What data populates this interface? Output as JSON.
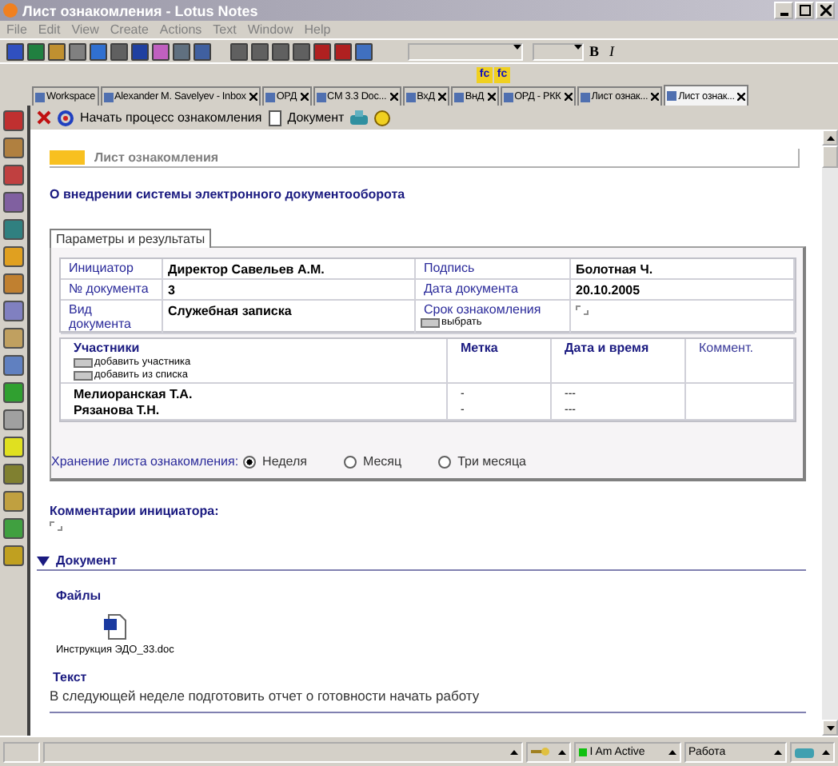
{
  "window": {
    "title": "Лист ознакомления - Lotus Notes"
  },
  "menu": [
    "File",
    "Edit",
    "View",
    "Create",
    "Actions",
    "Text",
    "Window",
    "Help"
  ],
  "format_buttons": [
    "B",
    "I"
  ],
  "formula_buttons": [
    "fc",
    "fc"
  ],
  "tabs": [
    {
      "label": "Workspace",
      "selected": false,
      "closable": false
    },
    {
      "label": "Alexander M. Savelyev - Inbox",
      "selected": false,
      "closable": true
    },
    {
      "label": "ОРД",
      "selected": false,
      "closable": true
    },
    {
      "label": "CM 3.3 Doc...",
      "selected": false,
      "closable": true
    },
    {
      "label": "ВхД",
      "selected": false,
      "closable": true
    },
    {
      "label": "ВнД",
      "selected": false,
      "closable": true
    },
    {
      "label": "ОРД - РКК",
      "selected": false,
      "closable": true
    },
    {
      "label": "Лист ознак...",
      "selected": false,
      "closable": true
    },
    {
      "label": "Лист ознак...",
      "selected": true,
      "closable": true
    }
  ],
  "action_bar": [
    "Начать процесс ознакомления",
    "Документ"
  ],
  "form": {
    "header": "Лист ознакомления",
    "subject": "О внедрении системы электронного документооборота",
    "tab": "Параметры и результаты",
    "fields": [
      {
        "kind": "text",
        "label": "Инициатор",
        "value": "Директор Савельев А.М."
      },
      {
        "kind": "text",
        "label": "Подпись",
        "value": "Болотная Ч."
      },
      {
        "kind": "text",
        "label": "№ документа",
        "value": "3"
      },
      {
        "kind": "text",
        "label": "Дата документа",
        "value": "20.10.2005"
      },
      {
        "kind": "text",
        "label": "Вид документа",
        "value": "Служебная записка"
      },
      {
        "kind": "picker",
        "label": "Срок ознакомления",
        "button": "выбрать"
      }
    ],
    "participants": {
      "columns": [
        "Участники",
        "Метка",
        "Дата и время",
        "Коммент."
      ],
      "buttons": [
        "добавить участника",
        "добавить из списка"
      ],
      "rows": [
        {
          "name": "Мелиоранская Т.А.",
          "mark": "-",
          "datetime": "---"
        },
        {
          "name": "Рязанова Т.Н.",
          "mark": "-",
          "datetime": "---"
        }
      ]
    },
    "storage": {
      "label": "Хранение листа ознакомления:",
      "options": [
        {
          "label": "Неделя",
          "selected": true
        },
        {
          "label": "Месяц",
          "selected": false
        },
        {
          "label": "Три месяца",
          "selected": false
        }
      ]
    },
    "comments_label": "Комментарии инициатора:"
  },
  "section": {
    "title": "Документ",
    "expanded": true,
    "files_label": "Файлы",
    "attachment": "Инструкция ЭДО_33.doc",
    "text_label": "Текст",
    "text": "В следующей неделе подготовить отчет о готовности начать работу"
  },
  "status_bar": {
    "status": "I Am Active",
    "location": "Работа"
  }
}
